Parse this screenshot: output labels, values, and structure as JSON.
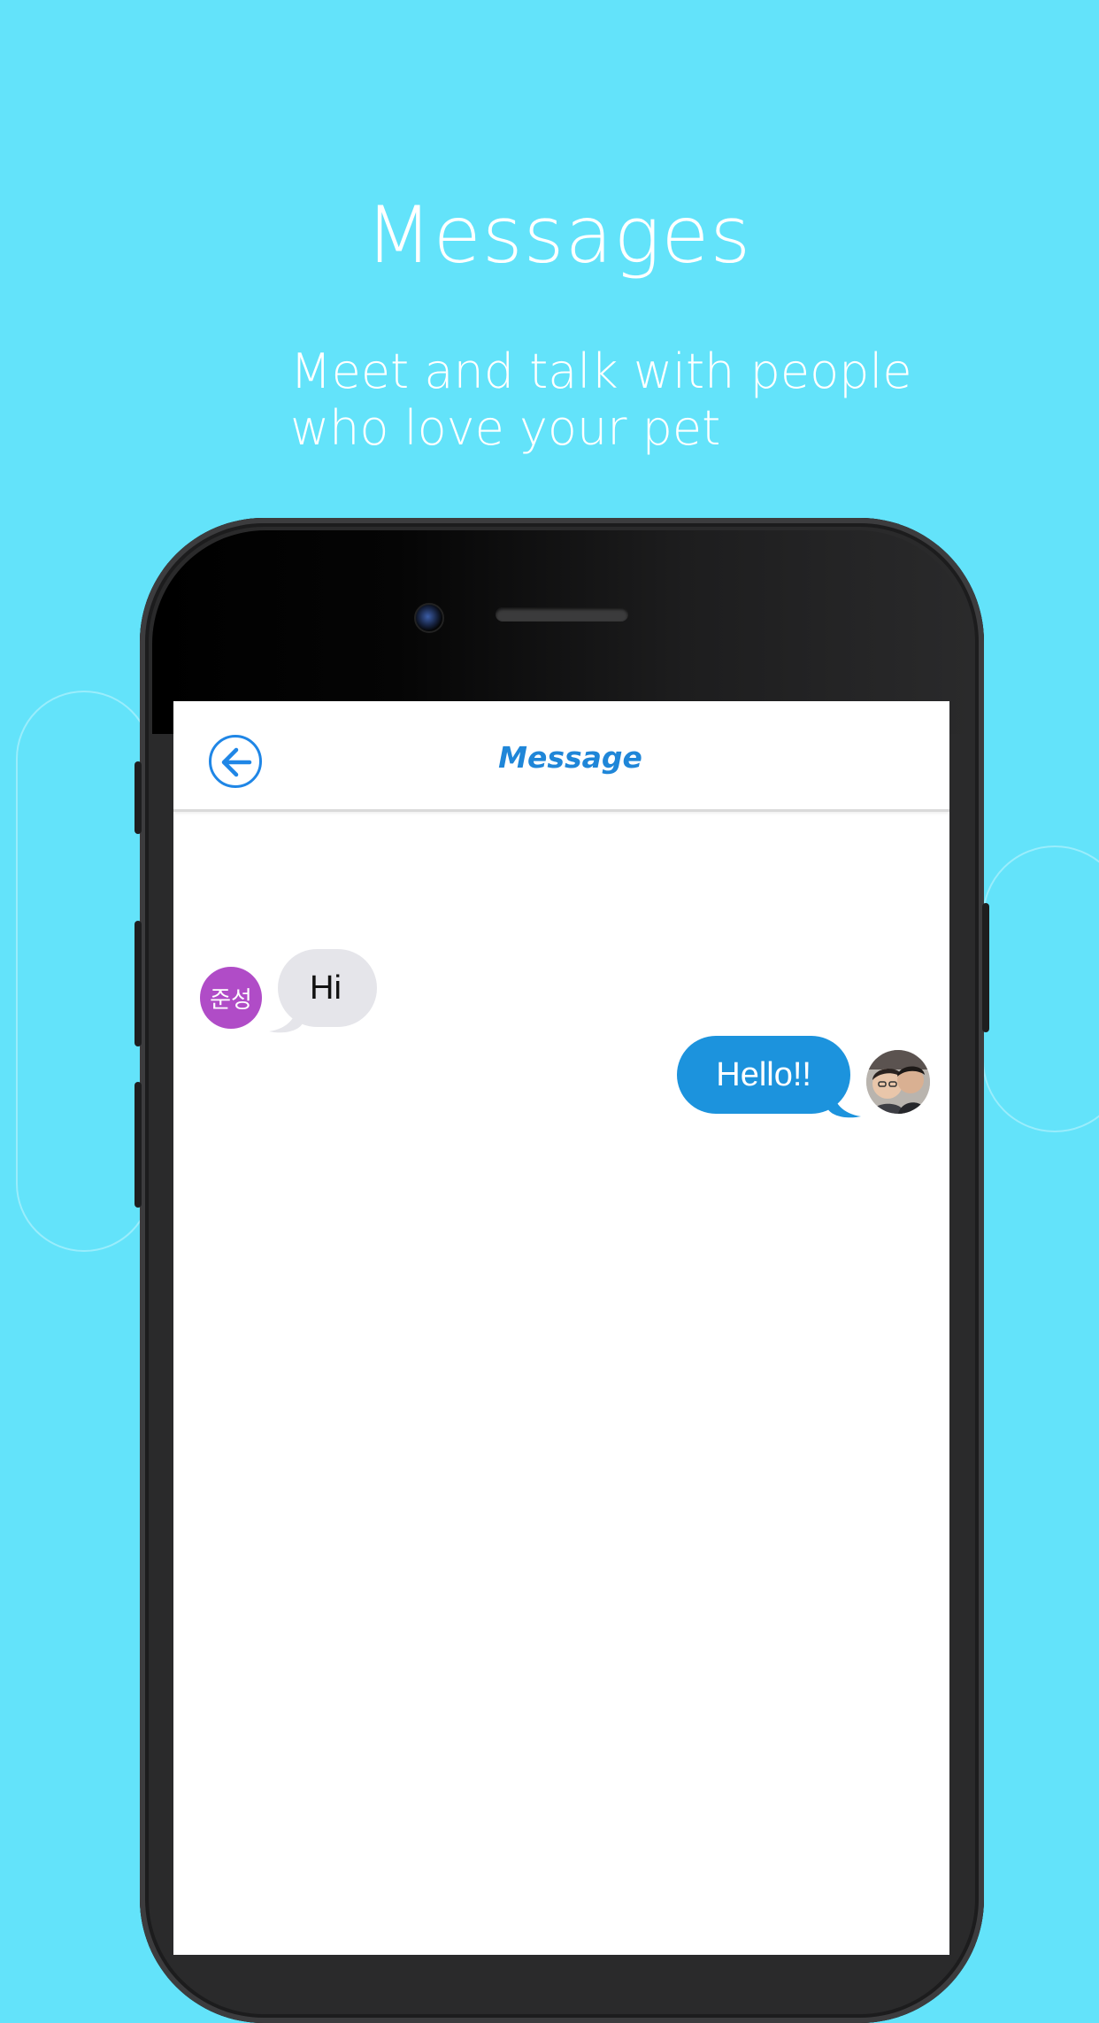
{
  "promo": {
    "title": "Messages",
    "subtitle_line1": "Meet and talk with people",
    "subtitle_line2": "who love your pet"
  },
  "nav": {
    "title": "Message",
    "back_icon": "arrow-left-circle-icon"
  },
  "messages": [
    {
      "direction": "incoming",
      "sender_avatar_text": "준성",
      "text": "Hi"
    },
    {
      "direction": "outgoing",
      "sender_avatar": "user-photo",
      "text": "Hello!!"
    }
  ],
  "colors": {
    "background": "#63e3fa",
    "accent": "#1f86d8",
    "incoming_bubble": "#e5e5ea",
    "outgoing_bubble": "#1c93dd",
    "avatar_badge": "#b04cc7"
  }
}
